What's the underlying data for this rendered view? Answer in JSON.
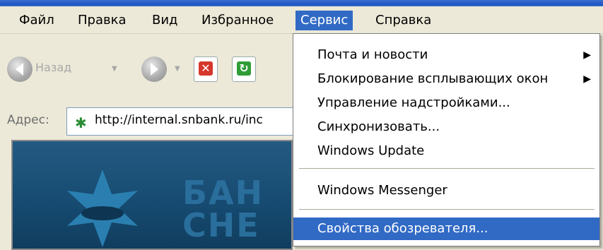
{
  "menubar": {
    "items": [
      "Файл",
      "Правка",
      "Вид",
      "Избранное",
      "Сервис",
      "Справка"
    ],
    "active_index": 4
  },
  "toolbar": {
    "back_label": "Назад",
    "dropdown_glyph": "▼"
  },
  "address": {
    "label": "Адрес:",
    "url": "http://internal.snbank.ru/inc"
  },
  "page": {
    "bank_line1": "БАН",
    "bank_line2": "СНЕ"
  },
  "service_menu": {
    "items": [
      {
        "label": "Почта и новости",
        "submenu": true
      },
      {
        "label": "Блокирование всплывающих окон",
        "submenu": true
      },
      {
        "label": "Управление надстройками...",
        "submenu": false
      },
      {
        "label": "Синхронизовать...",
        "submenu": false
      },
      {
        "label": "Windows Update",
        "submenu": false
      },
      {
        "label": "Windows Messenger",
        "submenu": false
      },
      {
        "label": "Свойства обозревателя...",
        "submenu": false,
        "highlighted": true
      }
    ],
    "submenu_glyph": "▶"
  },
  "colors": {
    "menu_highlight": "#316ac5",
    "chrome_bg": "#ece9d8"
  }
}
